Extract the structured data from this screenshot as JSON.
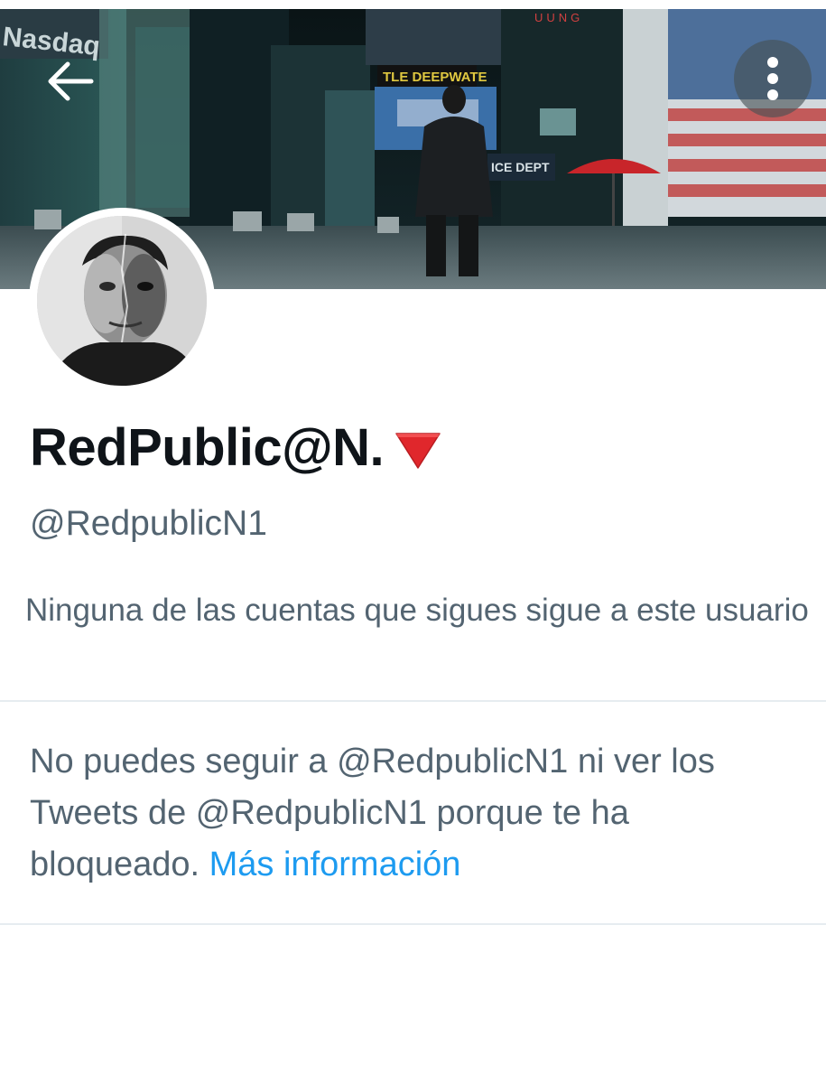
{
  "header": {
    "back_icon": "arrow-left-icon",
    "more_icon": "more-vertical-icon",
    "banner_text": {
      "nasdaq": "Nasdaq",
      "ticker": "TLE DEEPWATE",
      "sign_vertical": "UUNG",
      "police_dept": "ICE DEPT"
    }
  },
  "profile": {
    "display_name": "RedPublic@N.",
    "name_emoji": "red-triangle-down-icon",
    "handle": "@RedpublicN1",
    "followers_note": "Ninguna de las cuentas que sigues sigue a este usuario"
  },
  "blocked": {
    "message": "No puedes seguir a @RedpublicN1 ni ver los Tweets de @RedpublicN1 porque te ha bloqueado.",
    "link_label": "Más información"
  },
  "colors": {
    "text_primary": "#0f1419",
    "text_secondary": "#536471",
    "link": "#1d9bf0",
    "divider": "#e6ecf0",
    "emoji_red": "#e0272c"
  }
}
